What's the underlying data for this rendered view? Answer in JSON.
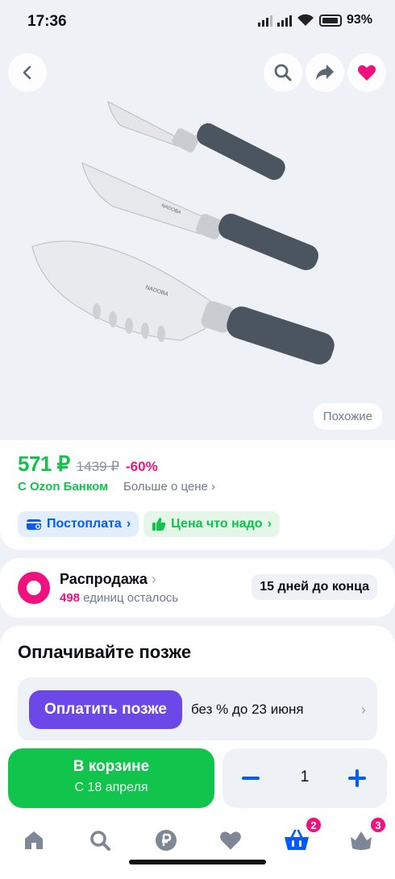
{
  "status_bar": {
    "time": "17:36",
    "battery": "93%"
  },
  "product": {
    "price": "571 ₽",
    "old_price": "1439 ₽",
    "discount": "-60%",
    "bank_label": "С Ozon Банком",
    "more_price_link": "Больше о цене",
    "similar_button": "Похожие",
    "brand_text": "NADOBA"
  },
  "chips": [
    {
      "label": "Постоплата",
      "icon": "wallet-icon"
    },
    {
      "label": "Цена что надо",
      "icon": "thumbs-up-icon"
    }
  ],
  "sale": {
    "title": "Распродажа",
    "count": "498",
    "count_suffix": "единиц осталось",
    "days_left": "15 дней до конца"
  },
  "pay_later": {
    "title": "Оплачивайте позже",
    "button_label": "Оплатить позже",
    "terms": "без % до 23 июня"
  },
  "cart": {
    "title": "В корзине",
    "subtitle": "С 18 апреля",
    "quantity": "1"
  },
  "tabbar": {
    "cart_badge": "2",
    "profile_badge": "3"
  },
  "colors": {
    "price_green": "#10c44c",
    "discount_pink": "#f1117e",
    "ozon_blue": "#005bff",
    "pay_later_purple": "#6d48e8"
  }
}
